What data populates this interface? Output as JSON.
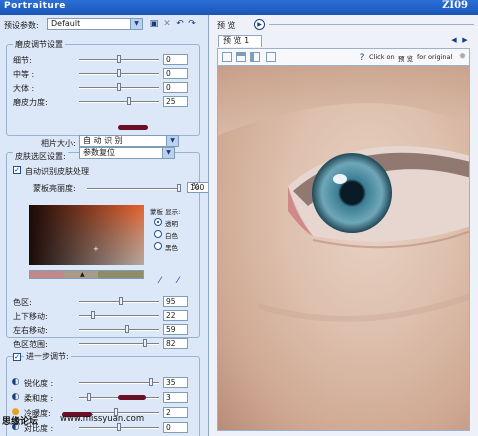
{
  "window": {
    "title": "Portraiture",
    "code": "ZI09"
  },
  "toolbar": {
    "preset_label": "预设参数:",
    "preset_value": "Default"
  },
  "smoothing": {
    "group_title": "磨皮调节设置",
    "sliders": [
      {
        "label": "细节:",
        "value": "0",
        "level": 0.5
      },
      {
        "label": "中等 :",
        "value": "0",
        "level": 0.5
      },
      {
        "label": "大体 :",
        "value": "0",
        "level": 0.5
      },
      {
        "label": "磨皮力度:",
        "value": "25",
        "level": 0.62
      }
    ],
    "portrait_size_label": "相片大小:",
    "portrait_size_value": "自 动 识 别"
  },
  "skin_mask": {
    "group_title": "皮肤选区设置:",
    "preset_value": "参数复位",
    "auto_label": "自动识别皮肤处理",
    "auto_checked": true,
    "opacity_label": "蒙板亮丽度:",
    "opacity_value": "100",
    "opacity_unit": "%",
    "opacity_level": 0.98,
    "display_label": "蒙板 显示:",
    "display_options": [
      {
        "label": "透明",
        "selected": true
      },
      {
        "label": "白色",
        "selected": false
      },
      {
        "label": "黑色",
        "selected": false
      }
    ],
    "sliders": [
      {
        "label": "色区:",
        "value": "95",
        "level": 0.52
      },
      {
        "label": "上下移动:",
        "value": "22",
        "level": 0.18
      },
      {
        "label": "左右移动:",
        "value": "59",
        "level": 0.6
      },
      {
        "label": "色区范围:",
        "value": "82",
        "level": 0.82
      }
    ]
  },
  "enhance": {
    "group_title": "进一步调节:",
    "checked": true,
    "sliders": [
      {
        "label": "锐化度 :",
        "value": "35",
        "level": 0.9,
        "icon": "half-moon-icon"
      },
      {
        "label": "柔和度 :",
        "value": "3",
        "level": 0.12,
        "icon": "half-moon-icon"
      },
      {
        "label": "冷暖度:",
        "value": "2",
        "level": 0.46,
        "icon": "sun-icon"
      },
      {
        "label": "对比度 :",
        "value": "0",
        "level": 0.5,
        "icon": "half-moon-icon"
      }
    ]
  },
  "preview": {
    "header_label": "预 览",
    "tab_label": "预 览 1",
    "hint_prefix": "Click on",
    "hint_cn": "预 览",
    "hint_suffix": "for original"
  },
  "watermark": {
    "cn": "思缘论坛",
    "url": "www.missyuan.com"
  },
  "colors": {
    "title_bar": "#1a55b8",
    "panel": "#dce7f7",
    "marker": "#6a0f26"
  }
}
